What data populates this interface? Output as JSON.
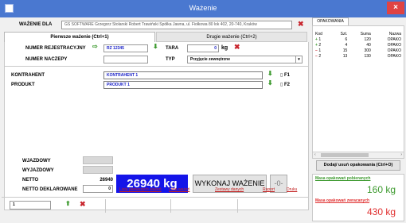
{
  "window": {
    "title": "Ważenie",
    "close_glyph": "×"
  },
  "header": {
    "label": "WAŻENIE DLA",
    "value": "GS SOFTWARE Grzegorz Stolarski Robert Trawiński Spółka Jawna, ul. Fiołkowa 80 lok 402, 20-740, Kraków"
  },
  "tabs": [
    {
      "label": "Pierwsze ważenie (Ctrl+1)",
      "active": true
    },
    {
      "label": "Drugie ważenie (Ctrl+2)",
      "active": false
    }
  ],
  "form": {
    "reg_label": "NUMER REJESTRACYJNY",
    "reg_value": "RZ 12345",
    "tara_label": "TARA",
    "tara_value": "0",
    "tara_unit": "kg",
    "trailer_label": "NUMER NACZEPY",
    "trailer_value": "",
    "type_label": "TYP",
    "type_value": "Przyjęcie zewnętrzne",
    "contractor_label": "KONTRAHENT",
    "contractor_value": "KONTRAHENT 1",
    "contractor_key": "F1",
    "product_label": "PRODUKT",
    "product_value": "PRODUKT 1",
    "product_key": "F2"
  },
  "summary": {
    "entry_label": "WJAZDOWY",
    "exit_label": "WYJAZDOWY",
    "net_label": "NETTO",
    "net_value": "26940",
    "declared_label": "NETTO DEKLAROWANE",
    "declared_value": "0",
    "weight_display": "26940 kg",
    "weigh_button": "WYKONAJ WAŻENIE",
    "zero_button": "-0-"
  },
  "links": [
    "Lista pierwszych ważeń",
    "Lista ważeń",
    "Zestawy danych",
    "Raport",
    "Druku"
  ],
  "bottom": {
    "counter_value": "1"
  },
  "packaging": {
    "tab_label": "OPAKOWANIA",
    "columns": [
      "Kod",
      "Szt.",
      "Suma",
      "Nazwa"
    ],
    "rows": [
      {
        "sign": "+",
        "color": "#3d9a2f",
        "code": "1",
        "qty": "6",
        "sum": "120",
        "name": "OPAKO"
      },
      {
        "sign": "+",
        "color": "#3d9a2f",
        "code": "2",
        "qty": "4",
        "sum": "40",
        "name": "OPAKO"
      },
      {
        "sign": "−",
        "color": "#c8242c",
        "code": "1",
        "qty": "15",
        "sum": "300",
        "name": "OPAKO"
      },
      {
        "sign": "−",
        "color": "#c8242c",
        "code": "2",
        "qty": "13",
        "sum": "130",
        "name": "OPAKO"
      }
    ],
    "add_button": "Dodaj/ usuń opakowania (Ctrl+O)",
    "collected_label": "Masa opakowań pobieranych",
    "collected_value": "160 kg",
    "returned_label": "Masa opakowań zwracanych",
    "returned_value": "430 kg"
  },
  "colors": {
    "title_bar": "#4a78d0",
    "weight_bg": "#1414e8",
    "green": "#3d9a2f",
    "red": "#e03030"
  }
}
